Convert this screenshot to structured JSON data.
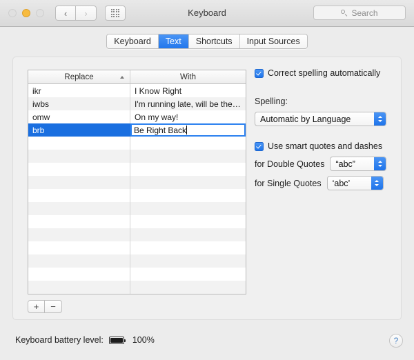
{
  "window": {
    "title": "Keyboard",
    "traffic_lights": [
      "close",
      "minimize",
      "maximize"
    ]
  },
  "toolbar": {
    "back_icon": "chevron-left-icon",
    "forward_icon": "chevron-right-icon",
    "show_all_icon": "grid-icon",
    "search": {
      "placeholder": "Search",
      "icon": "search-icon",
      "value": ""
    }
  },
  "tabs": [
    {
      "label": "Keyboard",
      "active": false
    },
    {
      "label": "Text",
      "active": true
    },
    {
      "label": "Shortcuts",
      "active": false
    },
    {
      "label": "Input Sources",
      "active": false
    }
  ],
  "table": {
    "columns": [
      "Replace",
      "With"
    ],
    "sort_column": "Replace",
    "sort_direction": "ascending",
    "rows": [
      {
        "replace": "ikr",
        "with": "I Know Right",
        "selected": false,
        "editing": false
      },
      {
        "replace": "iwbs",
        "with": "I'm running late, will be the…",
        "selected": false,
        "editing": false
      },
      {
        "replace": "omw",
        "with": "On my way!",
        "selected": false,
        "editing": false
      },
      {
        "replace": "brb",
        "with": "Be Right Back",
        "selected": true,
        "editing": true
      }
    ],
    "empty_row_count": 13
  },
  "list_controls": {
    "add_label": "+",
    "remove_label": "−"
  },
  "options": {
    "correct_spelling": {
      "label": "Correct spelling automatically",
      "checked": true
    },
    "spelling": {
      "label": "Spelling:",
      "value": "Automatic by Language"
    },
    "smart_quotes": {
      "label": "Use smart quotes and dashes",
      "checked": true
    },
    "double_quotes": {
      "label": "for Double Quotes",
      "value": "“abc”"
    },
    "single_quotes": {
      "label": "for Single Quotes",
      "value": "‘abc’"
    }
  },
  "status": {
    "battery_label": "Keyboard battery level:",
    "battery_percent": "100%",
    "battery_icon": "battery-full-icon",
    "help_label": "?"
  },
  "colors": {
    "accent_blue": "#2277ec",
    "selection_blue": "#1a6fe0",
    "amber": "#f7bb3f",
    "window_bg": "#ececec"
  }
}
